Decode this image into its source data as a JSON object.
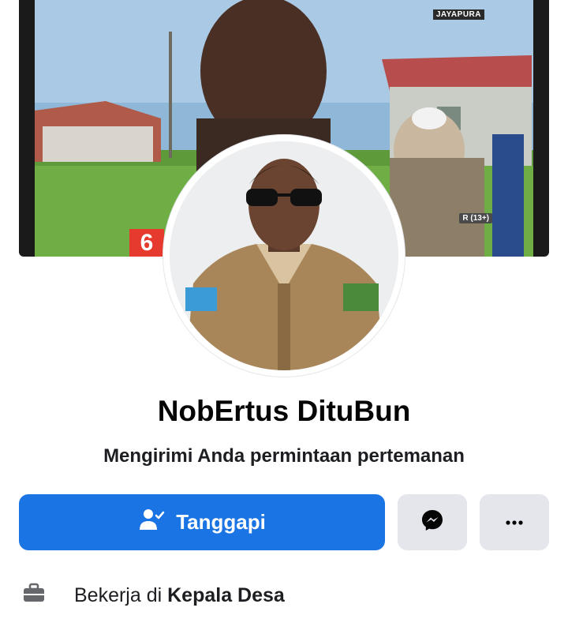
{
  "cover": {
    "watermark_station": "JAYAPURA",
    "watermark_rating": "R (13+)",
    "watermark_channel": "6"
  },
  "profile": {
    "name": "NobErtus DituBun",
    "subtitle": "Mengirimi Anda permintaan pertemanan"
  },
  "actions": {
    "respond_label": "Tanggapi",
    "respond_icon": "person-check-icon",
    "messenger_icon": "messenger-icon",
    "more_icon": "more-dots-icon"
  },
  "work": {
    "icon": "briefcase-icon",
    "prefix": "Bekerja di",
    "employer": "Kepala Desa"
  },
  "colors": {
    "primary": "#1b74e4",
    "secondary_button": "#e4e6eb",
    "text": "#050505"
  }
}
